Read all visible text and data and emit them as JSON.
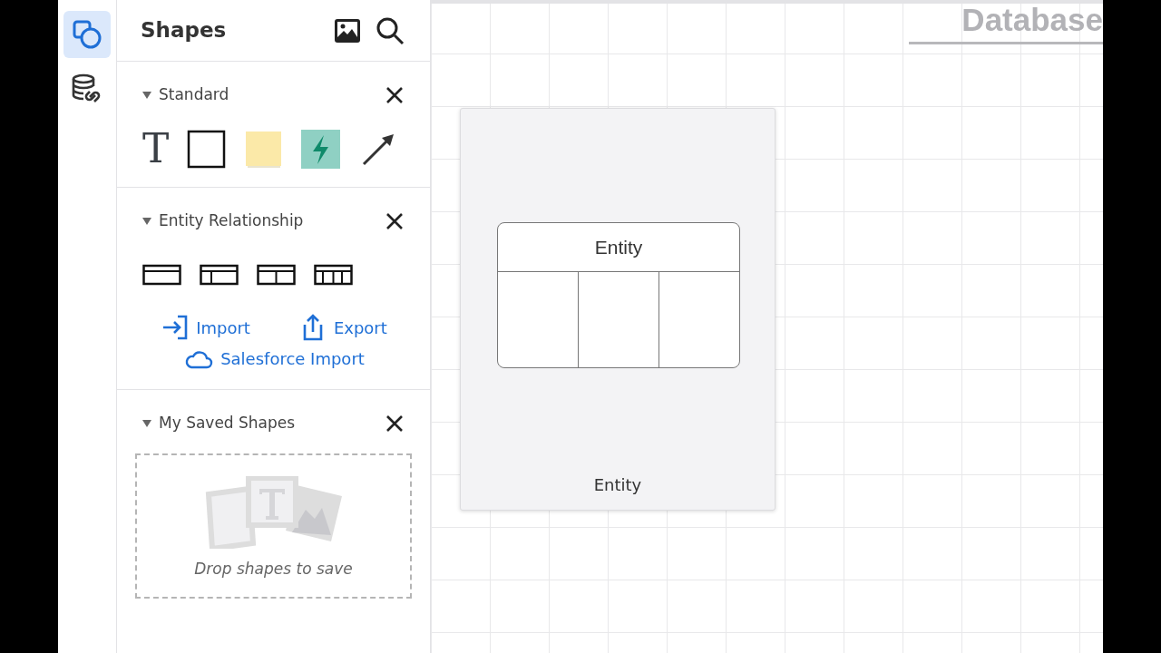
{
  "rail": [
    {
      "kind": "shapes",
      "selected": true
    },
    {
      "kind": "data",
      "selected": false
    }
  ],
  "panel": {
    "title": "Shapes",
    "sections": [
      {
        "title": "Standard",
        "expanded": true,
        "items": [
          {
            "kind": "text",
            "label": "T"
          },
          {
            "kind": "rect"
          },
          {
            "kind": "note"
          },
          {
            "kind": "action"
          },
          {
            "kind": "arrow"
          }
        ]
      },
      {
        "title": "Entity Relationship",
        "expanded": true,
        "items": [
          {
            "kind": "table1"
          },
          {
            "kind": "table2"
          },
          {
            "kind": "table3"
          },
          {
            "kind": "table4"
          }
        ],
        "links": [
          {
            "kind": "import",
            "label": "Import"
          },
          {
            "kind": "export",
            "label": "Export"
          },
          {
            "kind": "cloud",
            "label": "Salesforce Import"
          }
        ]
      },
      {
        "title": "My Saved Shapes",
        "expanded": true,
        "hint": "Drop shapes to save"
      }
    ]
  },
  "canvas": {
    "title": "Database"
  },
  "preview": {
    "entity_title": "Entity",
    "caption": "Entity"
  }
}
